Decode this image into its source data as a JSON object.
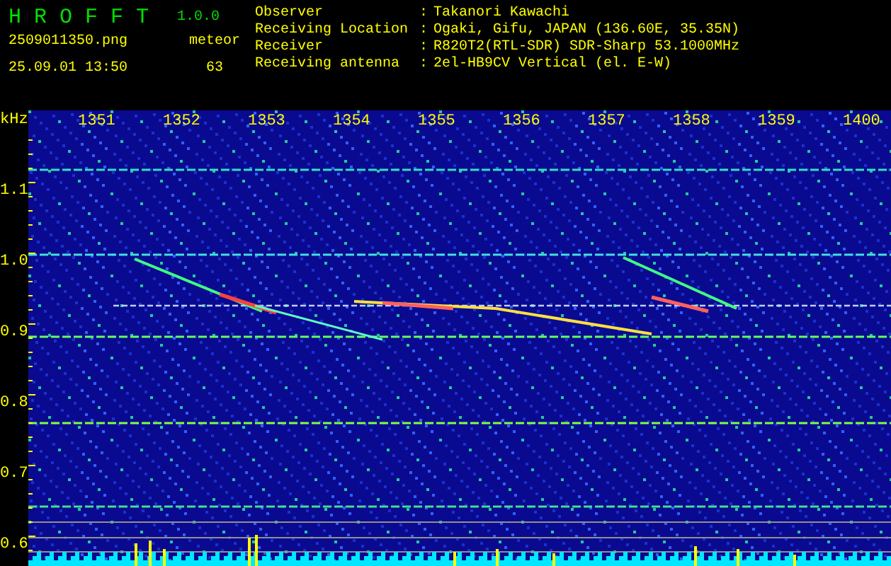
{
  "app": {
    "title": "H R O F F T",
    "version": "1.0.0",
    "filename": "2509011350.png",
    "timestamp": "25.09.01 13:50",
    "count_label": "meteor",
    "count": "63"
  },
  "info": [
    {
      "label": "Observer",
      "separator": ":",
      "value": "Takanori Kawachi"
    },
    {
      "label": "Receiving Location",
      "separator": ":",
      "value": "Ogaki, Gifu, JAPAN (136.60E, 35.35N)"
    },
    {
      "label": "Receiver",
      "separator": ":",
      "value": "R820T2(RTL-SDR) SDR-Sharp 53.1000MHz"
    },
    {
      "label": "Receiving antenna",
      "separator": ":",
      "value": "2el-HB9CV Vertical (el. E-W)"
    }
  ],
  "spectrogram": {
    "y_unit": "kHz",
    "y_ticks": [
      "1.1",
      "1.0",
      "0.9",
      "0.8",
      "0.7",
      "0.6"
    ],
    "x_ticks": [
      "1351",
      "1352",
      "1353",
      "1354",
      "1355",
      "1356",
      "1357",
      "1358",
      "1359",
      "1400"
    ]
  }
}
